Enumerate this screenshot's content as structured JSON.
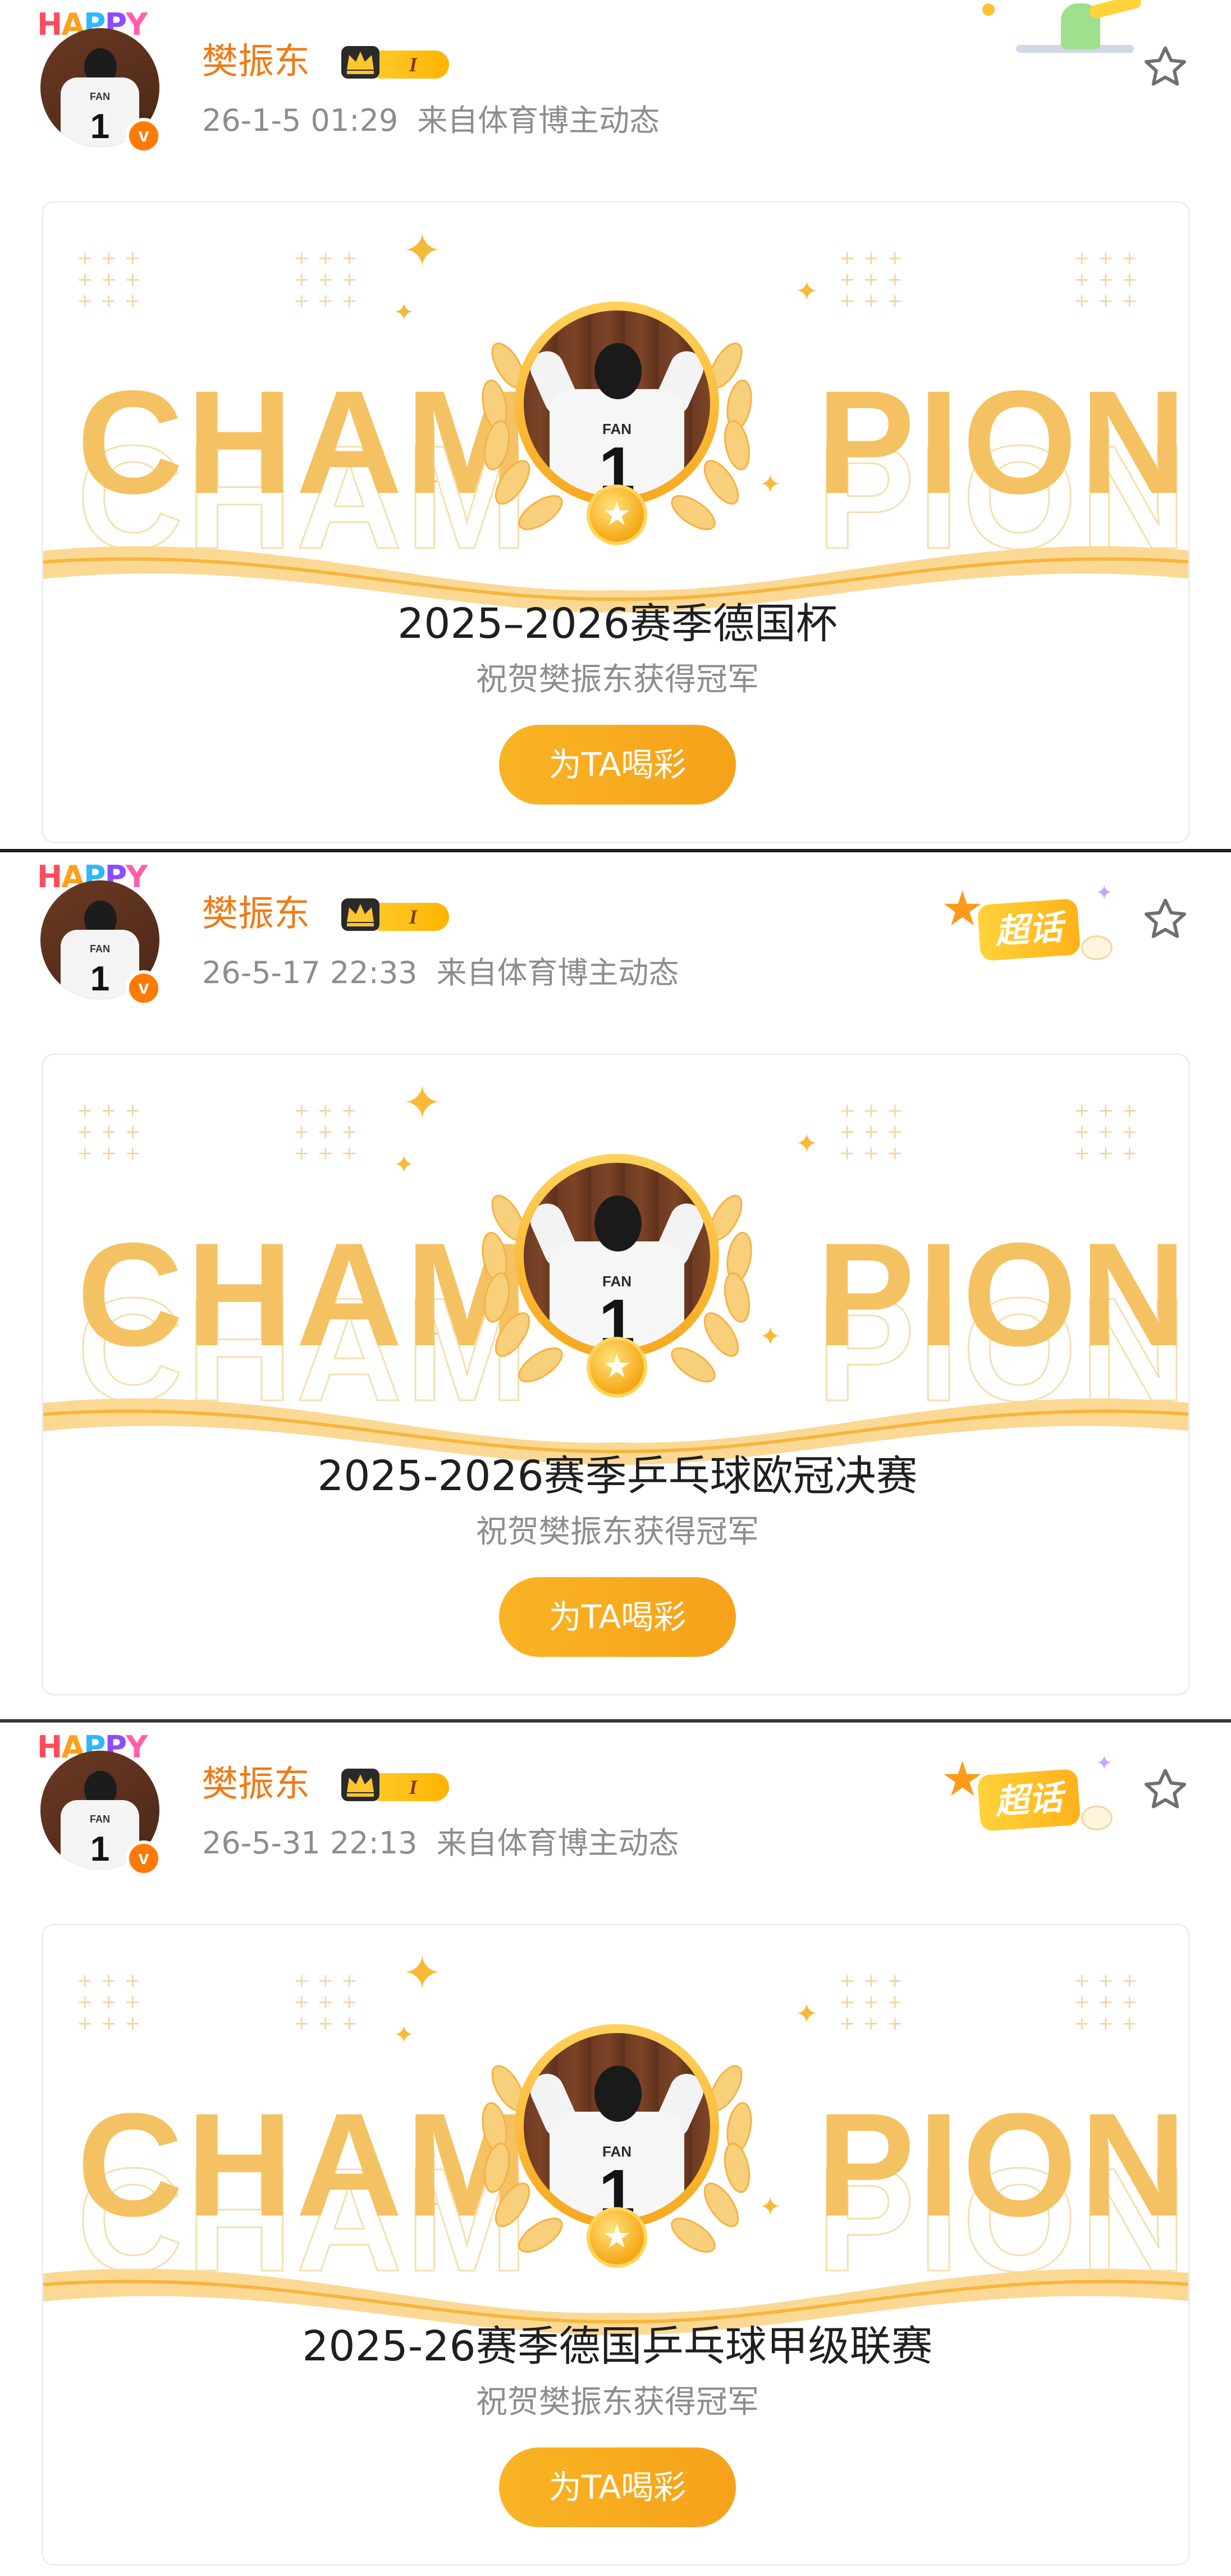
{
  "posts": [
    {
      "author": {
        "badge_text": "HAPPY",
        "name": "樊振东",
        "level": "I",
        "avatar_jersey_name": "FAN",
        "avatar_jersey_number": "1",
        "verified_mark": "v"
      },
      "meta": {
        "time": "26-1-5 01:29",
        "source": "来自体育博主动态"
      },
      "card": {
        "banner_left": "CHAM",
        "banner_right": "PION",
        "jersey_name": "FAN",
        "jersey_number": "1",
        "event_title": "2025–2026赛季德国杯",
        "congrats": "祝贺樊振东获得冠军",
        "cheer_label": "为TA喝彩"
      }
    },
    {
      "author": {
        "badge_text": "HAPPY",
        "name": "樊振东",
        "level": "I",
        "avatar_jersey_name": "FAN",
        "avatar_jersey_number": "1",
        "verified_mark": "v"
      },
      "meta": {
        "time": "26-5-17 22:33",
        "source": "来自体育博主动态"
      },
      "supertopic": {
        "label": "超话"
      },
      "card": {
        "banner_left": "CHAM",
        "banner_right": "PION",
        "jersey_name": "FAN",
        "jersey_number": "1",
        "event_title": "2025-2026赛季乒乓球欧冠决赛",
        "congrats": "祝贺樊振东获得冠军",
        "cheer_label": "为TA喝彩"
      }
    },
    {
      "author": {
        "badge_text": "HAPPY",
        "name": "樊振东",
        "level": "I",
        "avatar_jersey_name": "FAN",
        "avatar_jersey_number": "1",
        "verified_mark": "v"
      },
      "meta": {
        "time": "26-5-31 22:13",
        "source": "来自体育博主动态"
      },
      "supertopic": {
        "label": "超话"
      },
      "card": {
        "banner_left": "CHAM",
        "banner_right": "PION",
        "jersey_name": "FAN",
        "jersey_number": "1",
        "event_title": "2025-26赛季德国乒乓球甲级联赛",
        "congrats": "祝贺樊振东获得冠军",
        "cheer_label": "为TA喝彩"
      }
    }
  ],
  "icons": {
    "star": "star-outline-icon",
    "crown": "crown-icon",
    "verified": "verified-icon",
    "supertopic": "supertopic-star-icon",
    "medal": "medal-star-icon"
  },
  "colors": {
    "author_name": "#f07a16",
    "meta_text": "#8d8d8d",
    "champion_gold": "#f4c262",
    "cheer_button": "#f9b424",
    "verified_badge": "#ff7a00"
  }
}
